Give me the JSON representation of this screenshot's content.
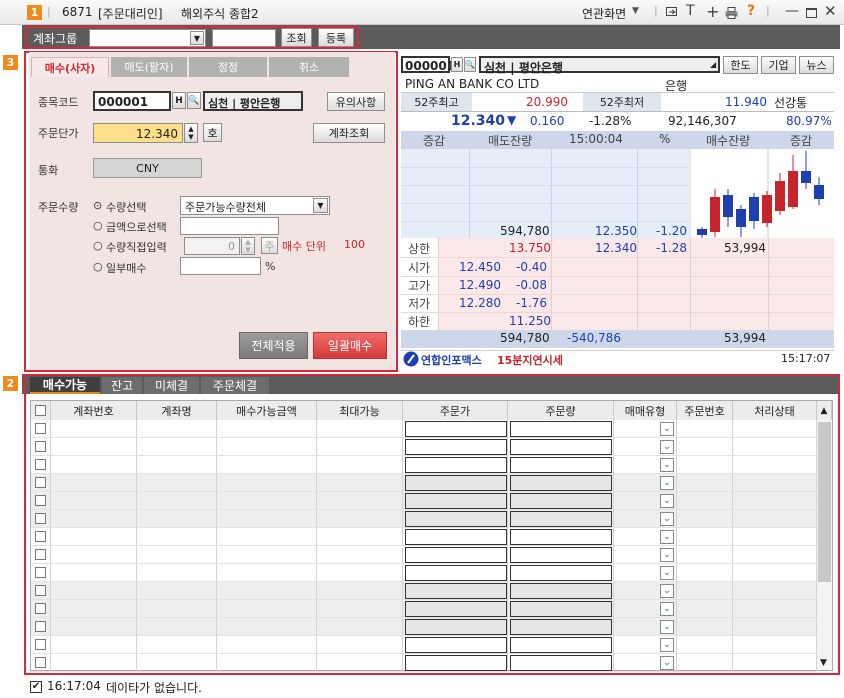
{
  "title": {
    "badge": "1",
    "code": "6871",
    "app": "[주문대리인]",
    "name": "해외주식 종합2",
    "linked": "연관화면"
  },
  "toolbar": {
    "account_group_label": "계좌그룹",
    "query": "조회",
    "register": "등록"
  },
  "badges": {
    "b2": "2",
    "b3": "3"
  },
  "order": {
    "tabs": [
      "매수(사자)",
      "매도(팔자)",
      "정정",
      "취소"
    ],
    "stock_code_label": "종목코드",
    "stock_code": "000001",
    "stock_name": "심천 | 평안은행",
    "notice": "유의사항",
    "price_label": "주문단가",
    "price": "12.340",
    "tick": "호",
    "account_query": "계좌조회",
    "currency_label": "통화",
    "currency": "CNY",
    "qty_label": "주문수량",
    "opt_qty": "수량선택",
    "qty_select": "주문가능수량전체",
    "opt_amount": "금액으로선택",
    "opt_direct": "수량직접입력",
    "direct_value": "0",
    "unit_btn": "주",
    "unit_text": "매수 단위",
    "unit_value": "100",
    "opt_partial": "일부매수",
    "percent": "%",
    "apply_all": "전체적용",
    "bulk_buy": "일괄매수"
  },
  "quote": {
    "code": "000001",
    "name": "심천 | 평안은행",
    "btn_limit": "한도",
    "btn_company": "기업",
    "btn_news": "뉴스",
    "eng_name": "PING AN BANK CO LTD",
    "sector": "은행",
    "w52_high_label": "52주최고",
    "w52_high": "20.990",
    "w52_low_label": "52주최저",
    "w52_low": "11.940",
    "dividend": "선강통",
    "price": "12.340",
    "arrow": "▼",
    "change": "0.160",
    "rate": "-1.28%",
    "volume": "92,146,307",
    "pct": "80.97%",
    "hdr": {
      "h1": "증감",
      "h2": "매도잔량",
      "time": "15:00:04",
      "pct": "%",
      "h3": "매수잔량",
      "h4": "증감"
    },
    "ask_total": "594,780",
    "cur_price": "12.350",
    "cur_rate": "-1.20",
    "upper_label": "상한",
    "upper": "13.750",
    "bid_price": "12.340",
    "bid_rate": "-1.28",
    "bid_qty": "53,994",
    "open_label": "시가",
    "open": "12.450",
    "open_chg": "-0.40",
    "high_label": "고가",
    "high": "12.490",
    "high_chg": "-0.08",
    "low_label": "저가",
    "low": "12.280",
    "low_chg": "-1.76",
    "lower_label": "하한",
    "lower": "11.250",
    "sum_ask": "594,780",
    "sum_diff": "-540,786",
    "sum_bid": "53,994",
    "source": "연합인포맥스",
    "delay": "15분지연시세",
    "time": "15:17:07"
  },
  "grid": {
    "tabs": [
      "매수가능",
      "잔고",
      "미체결",
      "주문체결"
    ],
    "columns": [
      "계좌번호",
      "계좌명",
      "매수가능금액",
      "최대가능",
      "주문가",
      "주문량",
      "매매유형",
      "주문번호",
      "처리상태"
    ]
  },
  "status": {
    "time": "16:17:04",
    "message": "데이타가 없습니다."
  },
  "colors": {
    "accent": "#d9263b",
    "badge": "#f08a1a"
  }
}
